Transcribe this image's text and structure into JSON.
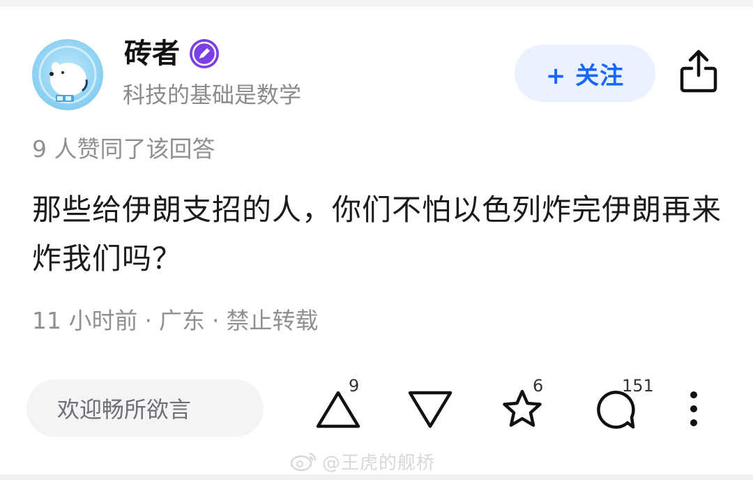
{
  "author": {
    "name": "砖者",
    "bio": "科技的基础是数学",
    "verified_icon": "pen-badge-icon",
    "avatar_icon": "polar-bear-avatar"
  },
  "header": {
    "follow_label": "+ 关注",
    "share_icon": "share-icon"
  },
  "answer": {
    "likes_note": "9 人赞同了该回答",
    "text": "那些给伊朗支招的人，你们不怕以色列炸完伊朗再来炸我们吗？",
    "time": "11 小时前",
    "location": "广东",
    "copyright": "禁止转载",
    "separator": "·"
  },
  "action_bar": {
    "comment_placeholder": "欢迎畅所欲言",
    "upvote_count": "9",
    "favorite_count": "6",
    "comment_count": "151",
    "icons": [
      "upvote-icon",
      "downvote-icon",
      "star-icon",
      "comment-icon",
      "more-icon"
    ]
  },
  "watermark": {
    "text": "@王虎的舰桥",
    "icon": "weibo-icon"
  },
  "colors": {
    "accent": "#1766ff",
    "follow_bg": "#eaf2ff",
    "muted_text": "#8f8f94",
    "verified_purple": "#7b3fe4"
  }
}
